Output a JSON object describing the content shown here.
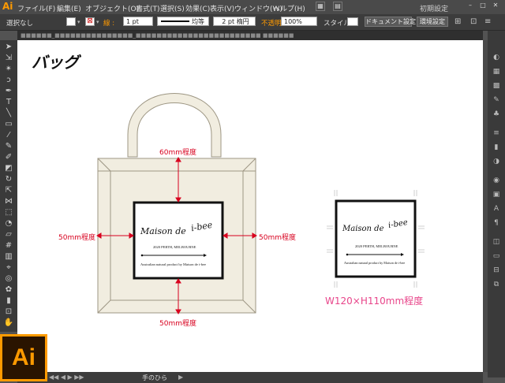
{
  "app": {
    "logo": "Ai",
    "badge": "Ai"
  },
  "menubar": {
    "items": [
      "ファイル(F)",
      "編集(E)",
      "オブジェクト(O)",
      "書式(T)",
      "選択(S)",
      "効果(C)",
      "表示(V)",
      "ウィンドウ(W)",
      "ヘルプ(H)"
    ],
    "workspace": "初期設定"
  },
  "control_bar": {
    "selection_status": "選択なし",
    "stroke_label": "線 :",
    "stroke_width": "1 pt",
    "profile_label": "均等",
    "brush_label": "2 pt 楕円",
    "opacity_label": "不透明度 :",
    "opacity_value": "100%",
    "style_label": "スタイル :",
    "doc_settings_button": "ドキュメント設定",
    "preferences_button": "環境設定"
  },
  "document_tab": "■■■■■■_■■■■■■■■■■■■■■■_■■■■■■■■■■■■■■■■■■■■■■■■ ■■■■■■",
  "status_bar": {
    "zoom": "",
    "tool_status": "手のひら"
  },
  "artwork": {
    "title": "バッグ",
    "brand": "Maison de",
    "brand_mark": "i-bee",
    "location_line": "2020 PERTH, MELBOURNE",
    "tagline": "Australian natural product by Maison de i-bee",
    "dim_top": "60mm程度",
    "dim_left": "50mm程度",
    "dim_right": "50mm程度",
    "dim_bottom": "50mm程度",
    "size_note": "W120×H110mm程度"
  },
  "colors": {
    "accent": "#ff9a00",
    "dimension_red": "#d8001e",
    "size_note_pink": "#e8458a",
    "bag_fill": "#f1ede0",
    "bag_stroke": "#9d9683"
  }
}
